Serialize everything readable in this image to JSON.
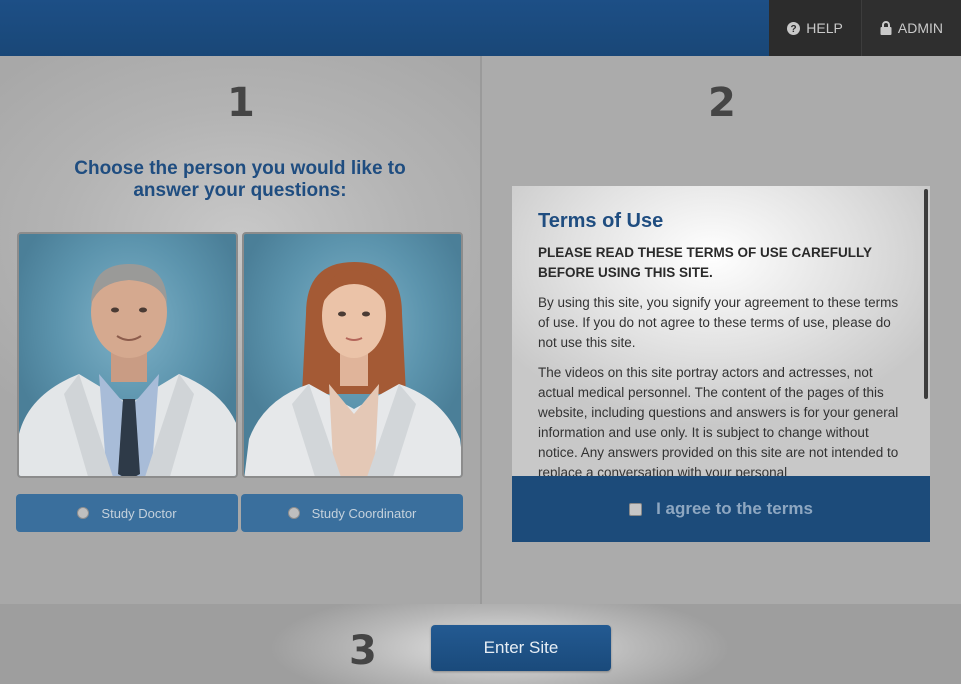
{
  "header": {
    "help_label": "HELP",
    "admin_label": "ADMIN"
  },
  "step1": {
    "number": "1",
    "title": "Choose the person you would like to answer your questions:",
    "options": [
      {
        "label": "Study Doctor"
      },
      {
        "label": "Study Coordinator"
      }
    ]
  },
  "step2": {
    "number": "2",
    "terms_title": "Terms of Use",
    "terms_caps": "PLEASE READ THESE TERMS OF USE CAREFULLY BEFORE USING THIS SITE.",
    "paragraphs": [
      "By using this site, you signify your agreement to these terms of use. If you do not agree to these terms of use, please do not use this site.",
      "The videos on this site portray actors and actresses, not actual medical personnel. The content of the pages of this website, including questions and answers is for your general information and use only. It is subject to change without notice. Any answers provided on this site are not intended to replace a conversation with your personal"
    ],
    "agree_label": "I agree to the terms"
  },
  "step3": {
    "number": "3",
    "enter_label": "Enter Site"
  }
}
